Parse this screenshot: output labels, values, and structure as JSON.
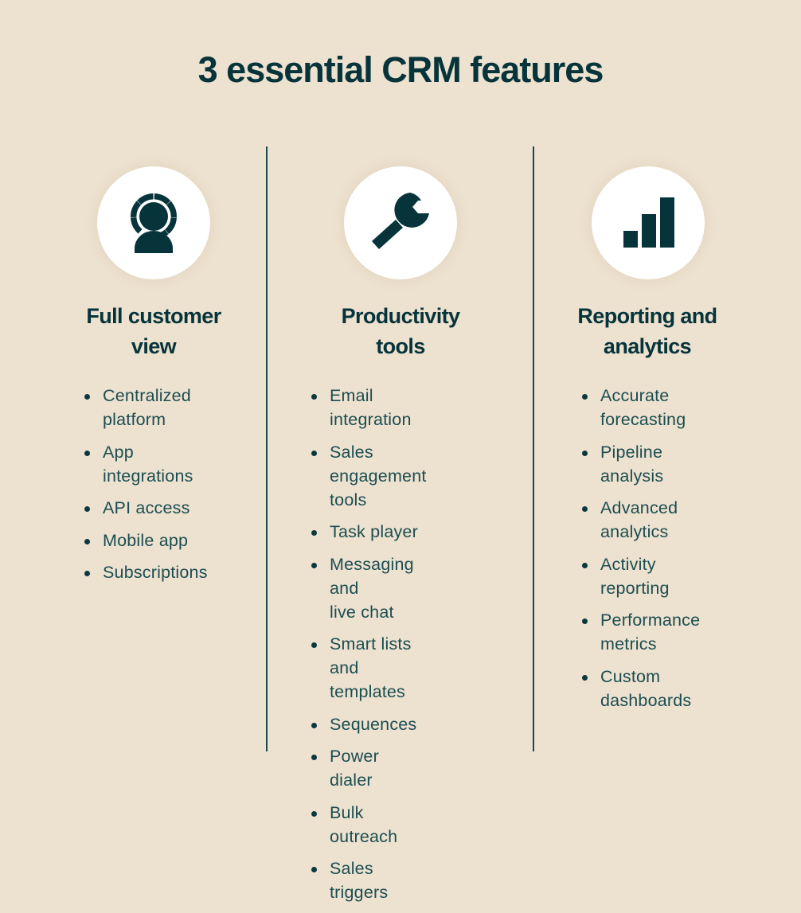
{
  "title": "3 essential CRM features",
  "colors": {
    "background": "#ede1cf",
    "ink": "#06343a",
    "circle": "#ffffff"
  },
  "columns": [
    {
      "icon": "customer-view-icon",
      "heading_line1": "Full customer",
      "heading_line2": "view",
      "items": [
        {
          "line1": "Centralized",
          "line2": "platform"
        },
        {
          "line1": "App",
          "line2": "integrations"
        },
        {
          "line1": "API access",
          "line2": ""
        },
        {
          "line1": "Mobile app",
          "line2": ""
        },
        {
          "line1": "Subscriptions",
          "line2": ""
        }
      ]
    },
    {
      "icon": "wrench-icon",
      "heading_line1": "Productivity",
      "heading_line2": "tools",
      "items": [
        {
          "line1": "Email integration",
          "line2": ""
        },
        {
          "line1": "Sales",
          "line2": "engagement tools"
        },
        {
          "line1": "Task player",
          "line2": ""
        },
        {
          "line1": "Messaging and",
          "line2": "live chat"
        },
        {
          "line1": "Smart lists and",
          "line2": "templates"
        },
        {
          "line1": "Sequences",
          "line2": ""
        },
        {
          "line1": "Power dialer",
          "line2": ""
        },
        {
          "line1": "Bulk outreach",
          "line2": ""
        },
        {
          "line1": "Sales triggers",
          "line2": ""
        }
      ]
    },
    {
      "icon": "bar-chart-icon",
      "heading_line1": "Reporting and",
      "heading_line2": "analytics",
      "items": [
        {
          "line1": "Accurate",
          "line2": "forecasting"
        },
        {
          "line1": "Pipeline",
          "line2": "analysis"
        },
        {
          "line1": "Advanced",
          "line2": "analytics"
        },
        {
          "line1": "Activity",
          "line2": "reporting"
        },
        {
          "line1": "Performance",
          "line2": "metrics"
        },
        {
          "line1": "Custom",
          "line2": "dashboards"
        }
      ]
    }
  ]
}
